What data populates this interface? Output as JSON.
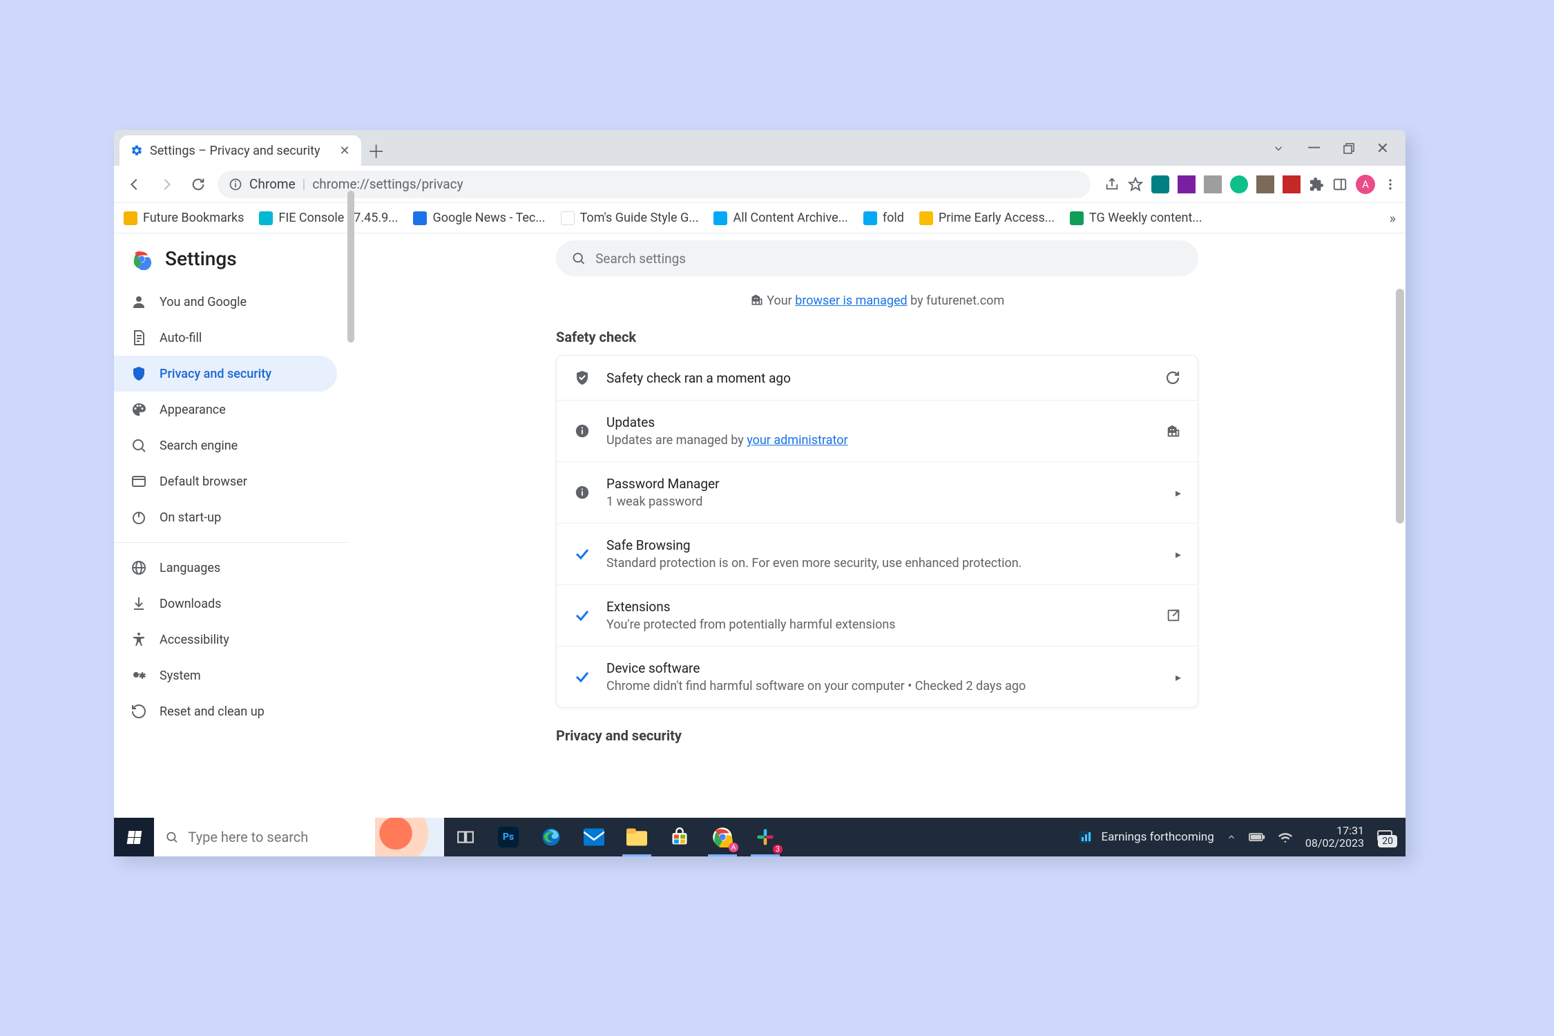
{
  "tab": {
    "title": "Settings – Privacy and security"
  },
  "address": {
    "scheme_label": "Chrome",
    "url": "chrome://settings/privacy"
  },
  "toolbar_avatar": "A",
  "bookmarks": {
    "items": [
      {
        "label": "Future Bookmarks",
        "color": "#f4b400"
      },
      {
        "label": "FIE Console - 7.45.9...",
        "color": "#00b8d4"
      },
      {
        "label": "Google News - Tec...",
        "color": "#1a73e8"
      },
      {
        "label": "Tom's Guide Style G...",
        "color": "#ffffff"
      },
      {
        "label": "All Content Archive...",
        "color": "#03a9f4"
      },
      {
        "label": "fold",
        "color": "#03a9f4"
      },
      {
        "label": "Prime Early Access...",
        "color": "#fbbc04"
      },
      {
        "label": "TG Weekly content...",
        "color": "#0f9d58"
      }
    ]
  },
  "settings_title": "Settings",
  "search_placeholder": "Search settings",
  "managed": {
    "prefix": "Your ",
    "link": "browser is managed",
    "suffix": " by futurenet.com"
  },
  "nav": {
    "items": [
      {
        "id": "you",
        "label": "You and Google"
      },
      {
        "id": "autofill",
        "label": "Auto-fill"
      },
      {
        "id": "privacy",
        "label": "Privacy and security"
      },
      {
        "id": "appearance",
        "label": "Appearance"
      },
      {
        "id": "search",
        "label": "Search engine"
      },
      {
        "id": "default",
        "label": "Default browser"
      },
      {
        "id": "startup",
        "label": "On start-up"
      },
      {
        "id": "languages",
        "label": "Languages"
      },
      {
        "id": "downloads",
        "label": "Downloads"
      },
      {
        "id": "accessibility",
        "label": "Accessibility"
      },
      {
        "id": "system",
        "label": "System"
      },
      {
        "id": "reset",
        "label": "Reset and clean up"
      }
    ]
  },
  "sections": {
    "safety_check_title": "Safety check",
    "privacy_title": "Privacy and security"
  },
  "safety": {
    "header": "Safety check ran a moment ago",
    "rows": [
      {
        "title": "Updates",
        "sub_prefix": "Updates are managed by ",
        "sub_link": "your administrator",
        "sub_suffix": "",
        "icon": "info",
        "action": "building"
      },
      {
        "title": "Password Manager",
        "sub": "1 weak password",
        "icon": "info",
        "action": "caret"
      },
      {
        "title": "Safe Browsing",
        "sub": "Standard protection is on. For even more security, use enhanced protection.",
        "icon": "check",
        "action": "caret"
      },
      {
        "title": "Extensions",
        "sub": "You're protected from potentially harmful extensions",
        "icon": "check",
        "action": "open"
      },
      {
        "title": "Device software",
        "sub": "Chrome didn't find harmful software on your computer • Checked 2 days ago",
        "icon": "check",
        "action": "caret"
      }
    ]
  },
  "taskbar": {
    "search_placeholder": "Type here to search",
    "news": "Earnings forthcoming",
    "time": "17:31",
    "date": "08/02/2023",
    "badge": "20"
  }
}
